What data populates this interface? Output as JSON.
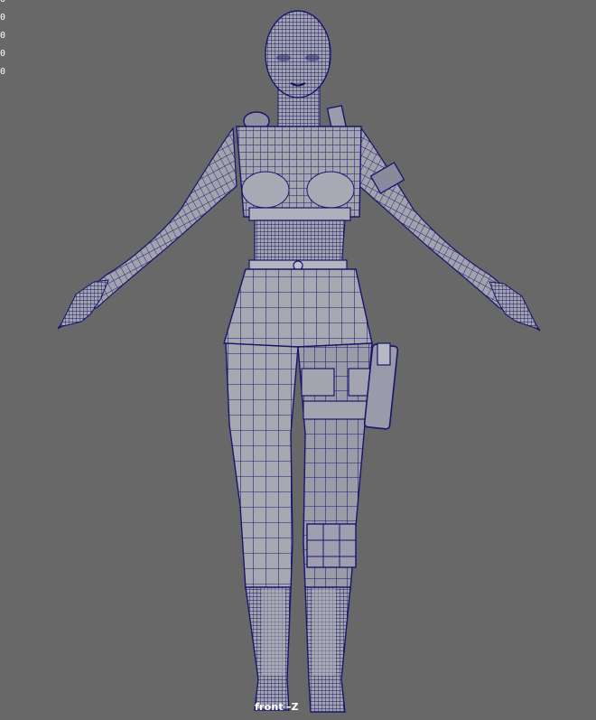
{
  "viewport": {
    "camera_label": "front -Z",
    "background_color": "#686868",
    "wire_color": "#16166e",
    "mesh_fill_color": "#a3a3ad"
  },
  "hud": {
    "values": [
      "0",
      "0",
      "0",
      "0",
      "0"
    ]
  },
  "model": {
    "name_icon": "character-mesh-icon"
  }
}
